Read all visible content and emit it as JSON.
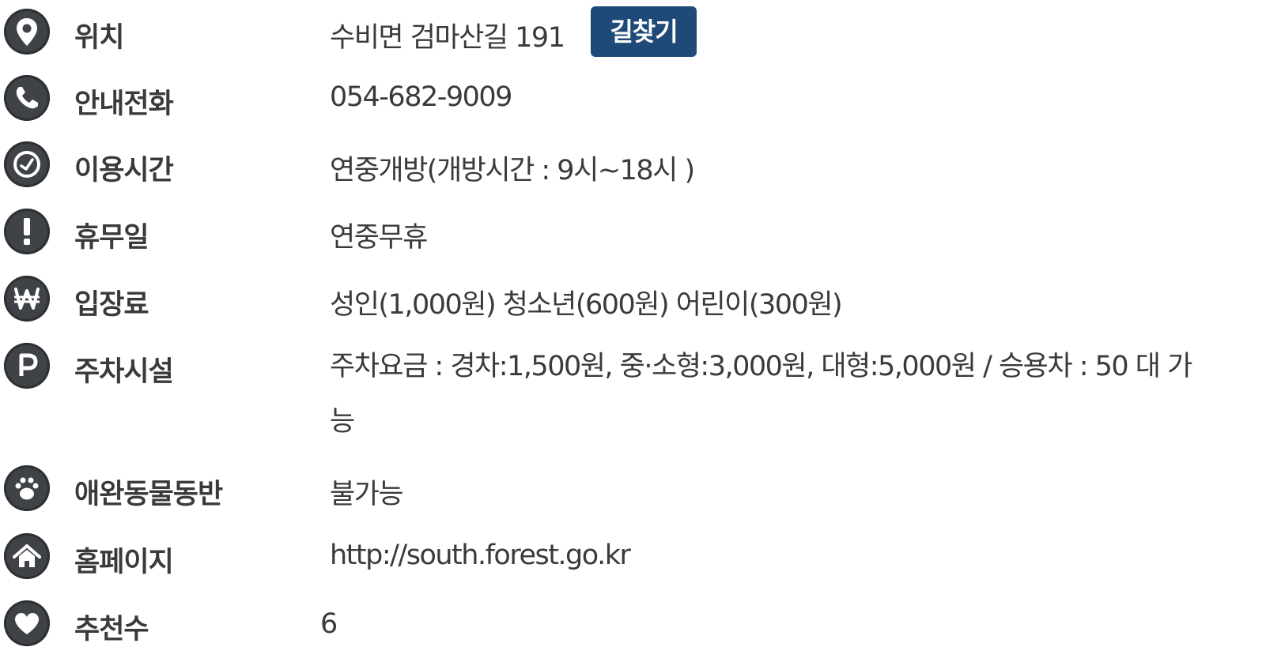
{
  "rows": [
    {
      "key": "location",
      "label": "위치",
      "value": "수비면 검마산길 191",
      "icon": "map-pin-icon"
    },
    {
      "key": "phone",
      "label": "안내전화",
      "value": "054-682-9009",
      "icon": "phone-icon"
    },
    {
      "key": "hours",
      "label": "이용시간",
      "value": "연중개방(개방시간 : 9시~18시 )",
      "icon": "clock-icon"
    },
    {
      "key": "closed",
      "label": "휴무일",
      "value": "연중무휴",
      "icon": "exclamation-icon"
    },
    {
      "key": "fee",
      "label": "입장료",
      "value": "성인(1,000원) 청소년(600원) 어린이(300원)",
      "icon": "won-icon"
    },
    {
      "key": "parking",
      "label": "주차시설",
      "value": "주차요금 : 경차:1,500원, 중·소형:3,000원, 대형:5,000원 / 승용차 : 50 대 가능",
      "icon": "parking-icon"
    },
    {
      "key": "pets",
      "label": "애완동물동반",
      "value": "불가능",
      "icon": "paw-icon"
    },
    {
      "key": "homepage",
      "label": "홈페이지",
      "value": "http://south.forest.go.kr",
      "icon": "home-icon"
    },
    {
      "key": "recommend",
      "label": "추천수",
      "value": "6",
      "icon": "heart-icon"
    }
  ],
  "directions_button": {
    "label": "길찾기"
  },
  "colors": {
    "icon_bg": "#3f4246",
    "button_bg": "#1f4a78",
    "text": "#3a3a3a"
  }
}
